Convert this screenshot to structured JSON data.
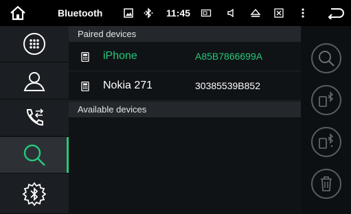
{
  "status_bar": {
    "title": "Bluetooth",
    "time": "11:45"
  },
  "sidebar": {
    "items": [
      {
        "name": "dialpad",
        "icon": "dialpad-icon"
      },
      {
        "name": "contacts",
        "icon": "contact-icon"
      },
      {
        "name": "call-log",
        "icon": "call-log-icon"
      },
      {
        "name": "search",
        "icon": "search-icon",
        "active": true
      },
      {
        "name": "bt-settings",
        "icon": "bluetooth-settings-icon"
      }
    ]
  },
  "main": {
    "paired_header": "Paired devices",
    "paired_devices": [
      {
        "name": "iPhone",
        "address": "A85B7866699A",
        "selected": true
      },
      {
        "name": "Nokia 271",
        "address": "30385539B852",
        "selected": false
      }
    ],
    "available_header": "Available devices"
  },
  "colors": {
    "accent": "#27c97b",
    "status_bar": "#000000",
    "sidebar": "#1b1e22",
    "section_header": "#24282c"
  }
}
